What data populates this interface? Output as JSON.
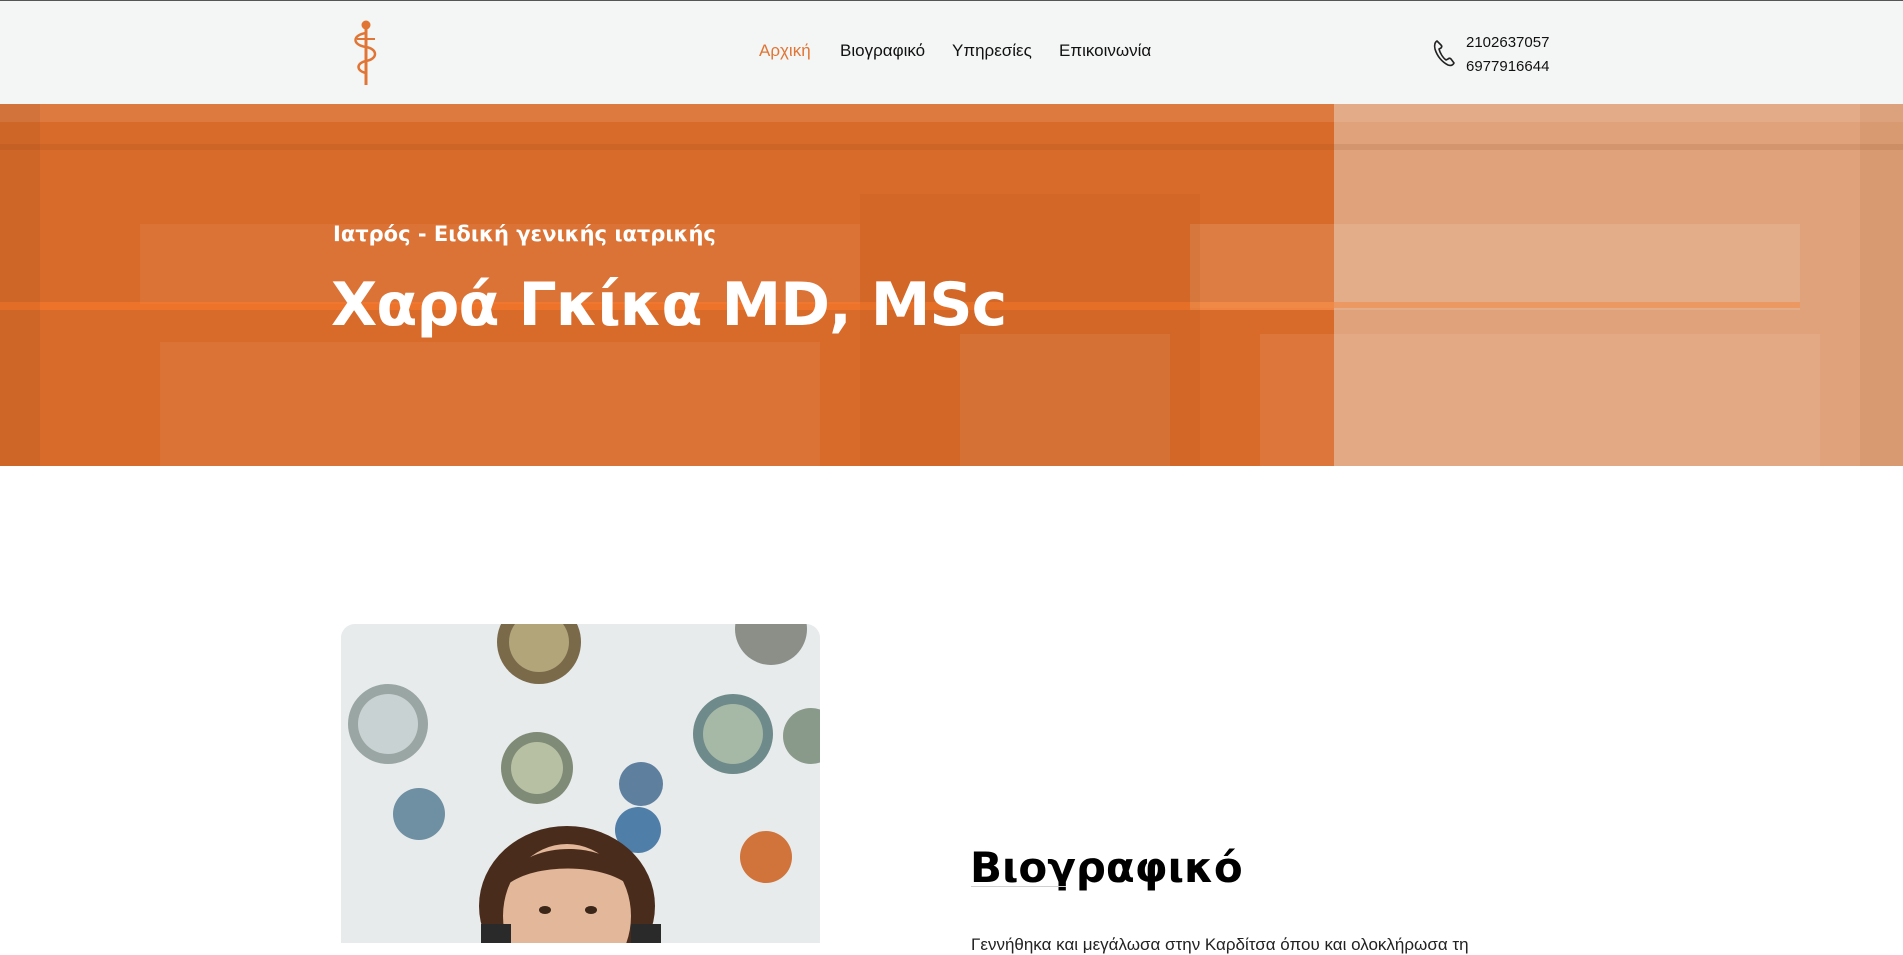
{
  "header": {
    "logo": "caduceus-logo-icon",
    "nav": [
      {
        "label": "Αρχική",
        "active": true
      },
      {
        "label": "Βιογραφικό",
        "active": false
      },
      {
        "label": "Υπηρεσίες",
        "active": false
      },
      {
        "label": "Επικοινωνία",
        "active": false
      }
    ],
    "phone_icon": "phone-icon",
    "phones": [
      "2102637057",
      "6977916644"
    ]
  },
  "hero": {
    "subtitle": "Ιατρός - Ειδική γενικής ιατρικής",
    "title": "Χαρά Γκίκα MD, MSc"
  },
  "about": {
    "heading": "Βιογραφικό",
    "text": "Γεννήθηκα και μεγάλωσα στην Καρδίτσα όπου και ολοκλήρωσα τη"
  },
  "colors": {
    "accent": "#e07535",
    "hero_overlay": "#d96b2a",
    "hero_overlay_pale": "#e0a27a",
    "header_bg": "#f4f6f5"
  }
}
